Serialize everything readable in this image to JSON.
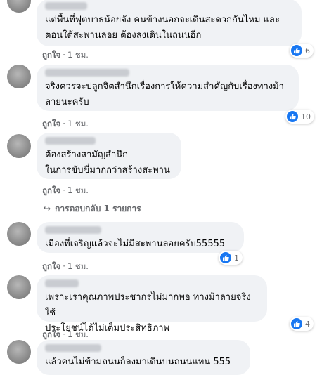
{
  "comments": [
    {
      "text": "แต่พื้นที่ฟุตบาธน้อยจัง คนข้างนอกจะเดินสะดวกกันไหม และ\nตอนใต้สะพานลอย ต้องลงเดินในถนนอีก",
      "like_label": "ถูกใจ",
      "time": "1 ชม.",
      "reaction_count": "6"
    },
    {
      "text": "จริงควรจะปลูกจิตสำนึกเรื่องการให้ความสำคัญกับเรื่องทางม้า\nลายนะครับ",
      "like_label": "ถูกใจ",
      "time": "1 ชม.",
      "reaction_count": "10"
    },
    {
      "text": "ต้องสร้างสามัญสำนึก\nในการขับขี่มากกว่าสร้างสะพาน",
      "like_label": "ถูกใจ",
      "time": "1 ชม.",
      "reply_label": "การตอบกลับ 1 รายการ"
    },
    {
      "text": "เมืองที่เจริญแล้วจะไม่มีสะพานลอยครับ55555",
      "like_label": "ถูกใจ",
      "time": "1 ชม.",
      "reaction_count": "1"
    },
    {
      "text": "เพราะเราคุณภาพประชากรไม่มากพอ ทางม้าลายจริงใช้\nประโยชน์ได้ไม่เต็มประสิทธิภาพ",
      "like_label": "ถูกใจ",
      "time": "1 ชม.",
      "reaction_count": "4"
    },
    {
      "text": "แล้วคนไม่ข้ามถนนก็ลงมาเดินบนถนนแทน 555"
    }
  ],
  "icons": {
    "reaction": "like-thumb-icon",
    "reply": "reply-arrow-icon"
  },
  "colors": {
    "bubble": "#f0f2f5",
    "meta": "#65676b",
    "like_blue": "#1877f2"
  }
}
